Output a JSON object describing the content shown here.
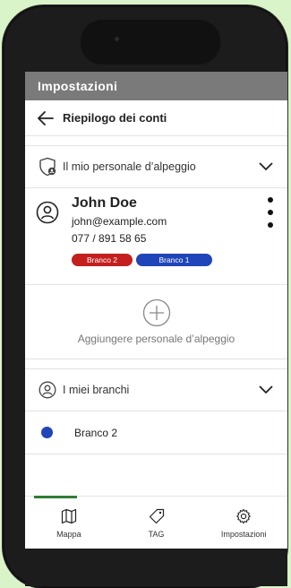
{
  "appbar": {
    "title": "Impostazioni"
  },
  "subheader": {
    "title": "Riepilogo dei conti"
  },
  "staff_section": {
    "label": "Il mio personale d’alpeggio"
  },
  "person": {
    "name": "John Doe",
    "email": "john@example.com",
    "phone": "077 / 891 58 65",
    "tags": [
      {
        "label": "Branco 2",
        "color": "#c41f1f"
      },
      {
        "label": "Branco 1",
        "color": "#1f45b8"
      }
    ]
  },
  "add_staff": {
    "label": "Aggiungere personale d’alpeggio"
  },
  "herds_section": {
    "label": "I miei branchi"
  },
  "herds": [
    {
      "label": "Branco 2",
      "color": "#1f45b8"
    }
  ],
  "bottom_nav": [
    {
      "label": "Mappa",
      "icon": "map-icon",
      "active": true
    },
    {
      "label": "TAG",
      "icon": "tag-icon",
      "active": false
    },
    {
      "label": "Impostazioni",
      "icon": "gear-icon",
      "active": false
    }
  ],
  "colors": {
    "appbar": "#7a7a7a",
    "active_tab": "#2f7d32",
    "background": "#d9f4c9"
  }
}
